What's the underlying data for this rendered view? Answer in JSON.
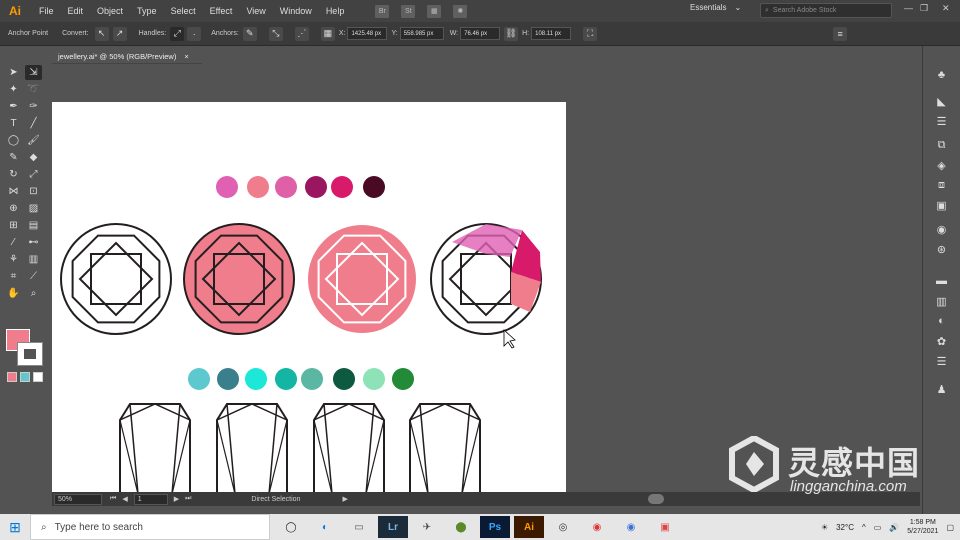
{
  "app": {
    "logo": "Ai"
  },
  "menu": [
    "File",
    "Edit",
    "Object",
    "Type",
    "Select",
    "Effect",
    "View",
    "Window",
    "Help"
  ],
  "menubar_icons": [
    "Br",
    "St"
  ],
  "workspace": {
    "label": "Essentials"
  },
  "stock_search": {
    "placeholder": "Search Adobe Stock"
  },
  "control_bar": {
    "anchor_point": "Anchor Point",
    "convert": "Convert:",
    "handles": "Handles:",
    "anchors": "Anchors:",
    "x_label": "X:",
    "x_value": "1425.48 px",
    "y_label": "Y:",
    "y_value": "558.985 px",
    "w_label": "W:",
    "w_value": "76.46 px",
    "h_label": "H:",
    "h_value": "108.11 px"
  },
  "document_tab": {
    "title": "jewellery.ai* @ 50% (RGB/Preview)",
    "close": "×"
  },
  "colors": {
    "pink_swatches": [
      "#e060b4",
      "#f07d8c",
      "#e060a8",
      "#9b1660",
      "#d81a6a",
      "#4a0a24"
    ],
    "teal_swatches": [
      "#5ec8cf",
      "#3a7f8c",
      "#1de8d8",
      "#14b5a3",
      "#5bb6a3",
      "#0e5a40",
      "#8ee2b8",
      "#238a38"
    ],
    "gem_pink": "#f07d8c",
    "gem_stroke": "#231f20"
  },
  "status_bar": {
    "zoom": "50%",
    "artboard": "1",
    "mode": "Direct Selection"
  },
  "taskbar": {
    "search_placeholder": "Type here to search",
    "apps": [
      "Lr",
      "Ps",
      "Ai"
    ],
    "temperature": "32°C",
    "time": "1:58 PM",
    "date": "5/27/2021"
  },
  "watermark": {
    "cn": "灵感中国",
    "url": "lingganchina.com"
  }
}
